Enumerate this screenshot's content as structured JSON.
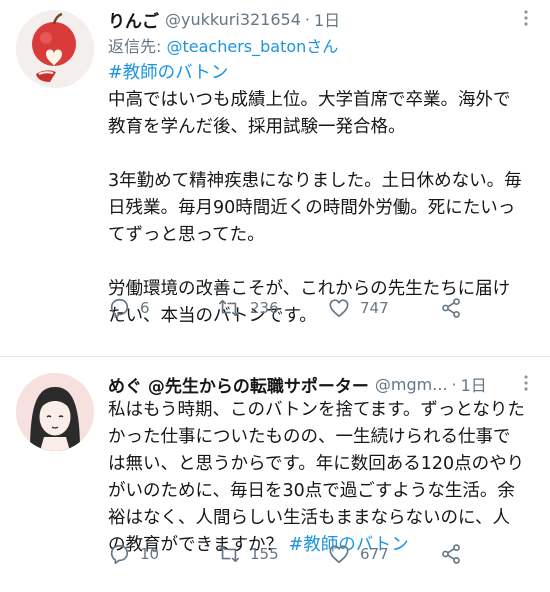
{
  "tweets": [
    {
      "name": "りんご",
      "handle": "@yukkuri321654",
      "dot": "·",
      "time": "1日",
      "reply_prefix": "返信先: ",
      "reply_to": "@teachers_batonさん",
      "hashtag_line": "#教師のバトン",
      "text": "中高ではいつも成績上位。大学首席で卒業。海外で\n教育を学んだ後、採用試験一発合格。\n\n3年勤めて精神疾患になりました。土日休めない。毎\n日残業。毎月90時間近くの時間外労働。死にたいっ\nてずっと思ってた。\n\n労働環境の改善こそが、これからの先生たちに届け\nたい、本当のバトンです。",
      "replies": "6",
      "retweets": "236",
      "likes": "747"
    },
    {
      "name": "めぐ @先生からの転職サポーター",
      "handle": "@mgm...",
      "dot": "·",
      "time": "1日",
      "text": "私はもう時期、このバトンを捨てます。ずっとなりた\nかった仕事についたものの、一生続けられる仕事で\nは無い、と思うからです。年に数回ある120点のやり\nがいのために、毎日を30点で過ごすような生活。余\n裕はなく、人間らしい生活もままならないのに、人\nの教育ができますか？ ",
      "hashtag": "#教師のバトン",
      "replies": "10",
      "retweets": "155",
      "likes": "677"
    }
  ],
  "colors": {
    "link": "#1b95e0",
    "secondary": "#657786",
    "text": "#14171a"
  }
}
